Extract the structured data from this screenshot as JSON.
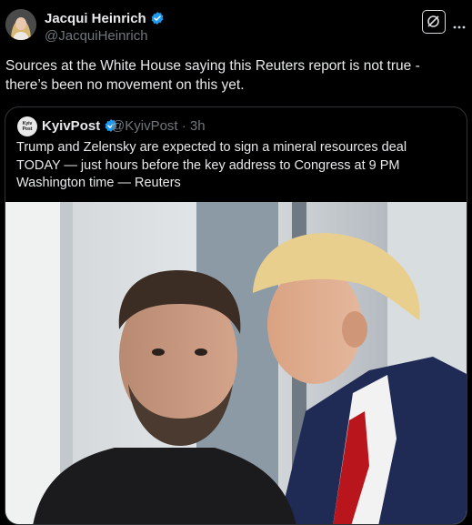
{
  "post": {
    "author_name": "Jacqui Heinrich",
    "author_handle": "@JacquiHeinrich",
    "text": "Sources at the White House saying this Reuters report is not true - there’s been no movement on this yet."
  },
  "quoted_post": {
    "source_avatar_text": "Kyiv Post",
    "author_name": "KyivPost",
    "author_handle": "@KyivPost · 3h",
    "text": "Trump and Zelensky are expected to sign a mineral resources deal TODAY — just hours before the key address to Congress at 9 PM Washington time — Reuters"
  },
  "icons": {
    "verified": "verified-badge-icon",
    "grok": "grok-icon",
    "more": "more-options-icon"
  },
  "colors": {
    "background": "#000000",
    "text_primary": "#e7e9ea",
    "text_secondary": "#71767b",
    "verified_blue": "#1d9bf0",
    "border": "#2f3336"
  }
}
